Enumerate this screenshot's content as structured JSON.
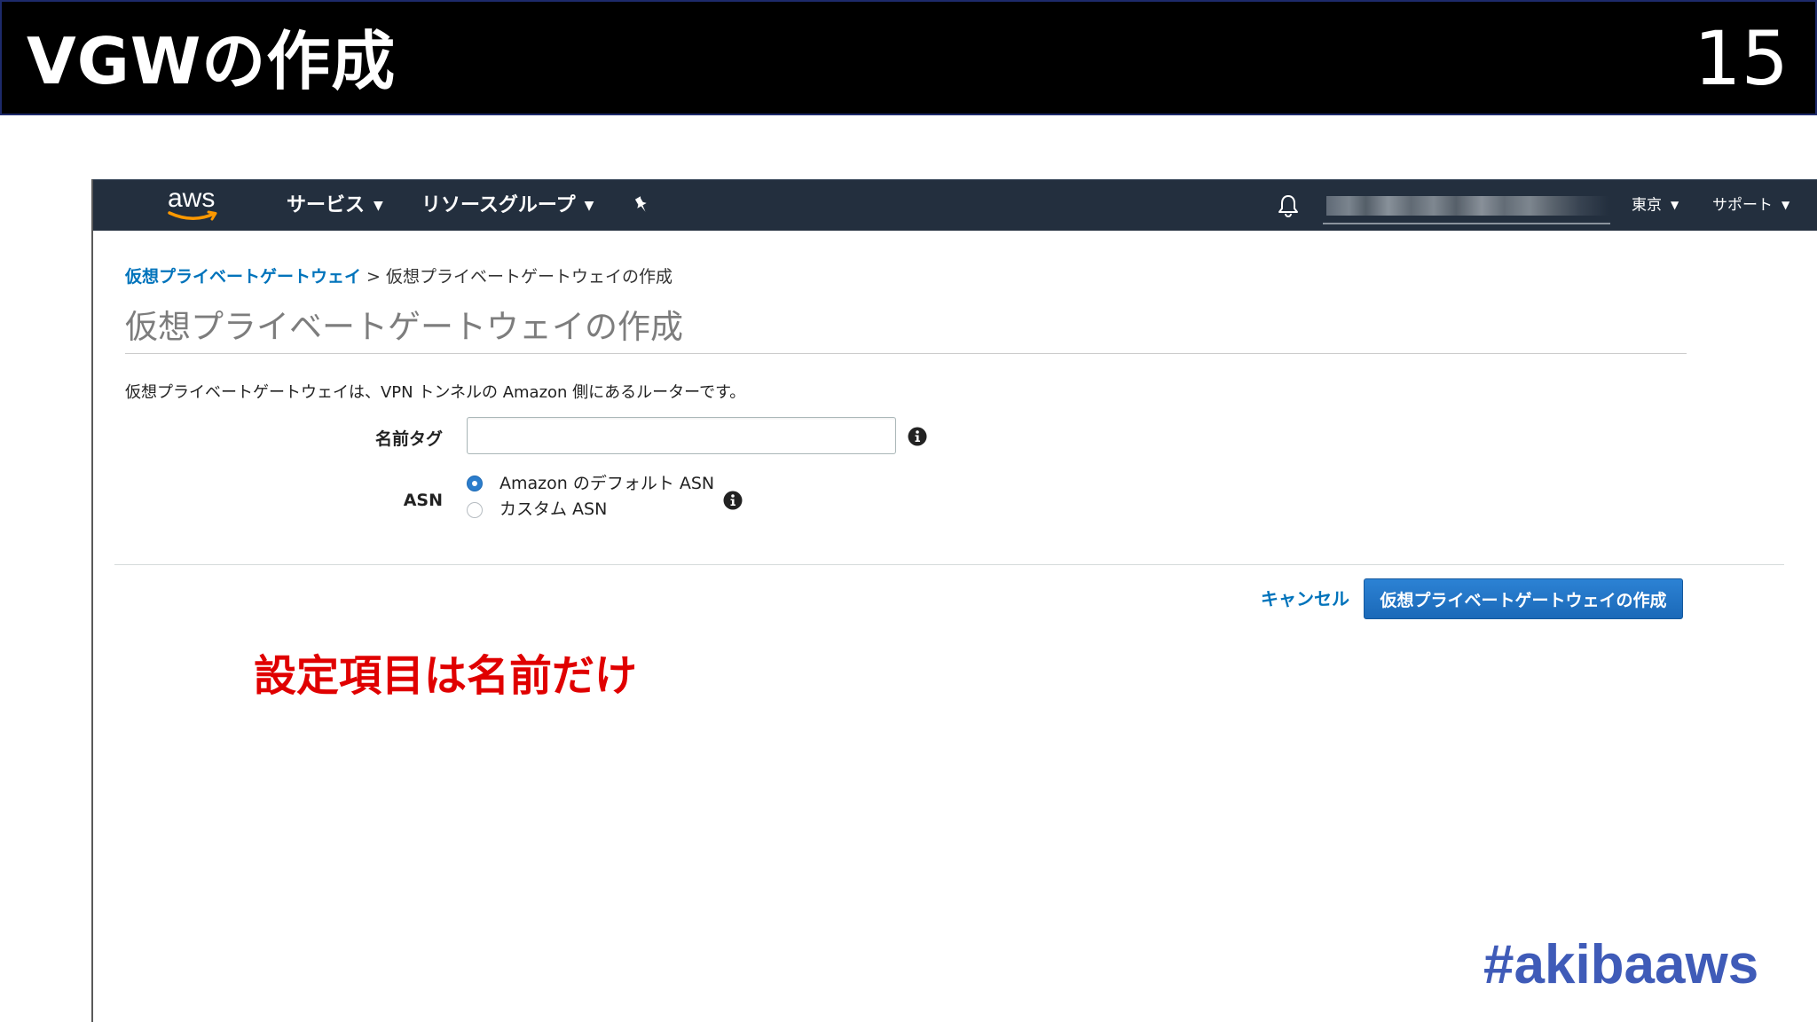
{
  "slide": {
    "title": "VGWの作成",
    "page_number": "15",
    "annotation": "設定項目は名前だけ",
    "hashtag": "#akibaaws"
  },
  "nav": {
    "logo_text": "aws",
    "services_label": "サービス",
    "resource_groups_label": "リソースグループ",
    "pin_icon": "pin-icon",
    "bell_icon": "bell-icon",
    "region_label": "東京",
    "support_label": "サポート"
  },
  "breadcrumb": {
    "parent_label": "仮想プライベートゲートウェイ",
    "separator": ">",
    "current_label": "仮想プライベートゲートウェイの作成"
  },
  "page": {
    "heading": "仮想プライベートゲートウェイの作成",
    "description": "仮想プライベートゲートウェイは、VPN トンネルの Amazon 側にあるルーターです。"
  },
  "form": {
    "name_tag_label": "名前タグ",
    "name_tag_value": "",
    "asn_label": "ASN",
    "asn_options": [
      {
        "label": "Amazon のデフォルト ASN",
        "selected": true
      },
      {
        "label": "カスタム ASN",
        "selected": false
      }
    ],
    "info_icon": "info-icon"
  },
  "actions": {
    "cancel_label": "キャンセル",
    "create_label": "仮想プライベートゲートウェイの作成"
  },
  "colors": {
    "nav_background": "#232f3e",
    "link": "#0073bb",
    "primary_button": "#1b69b8",
    "annotation": "#e00000",
    "hashtag": "#3f5bb8"
  }
}
